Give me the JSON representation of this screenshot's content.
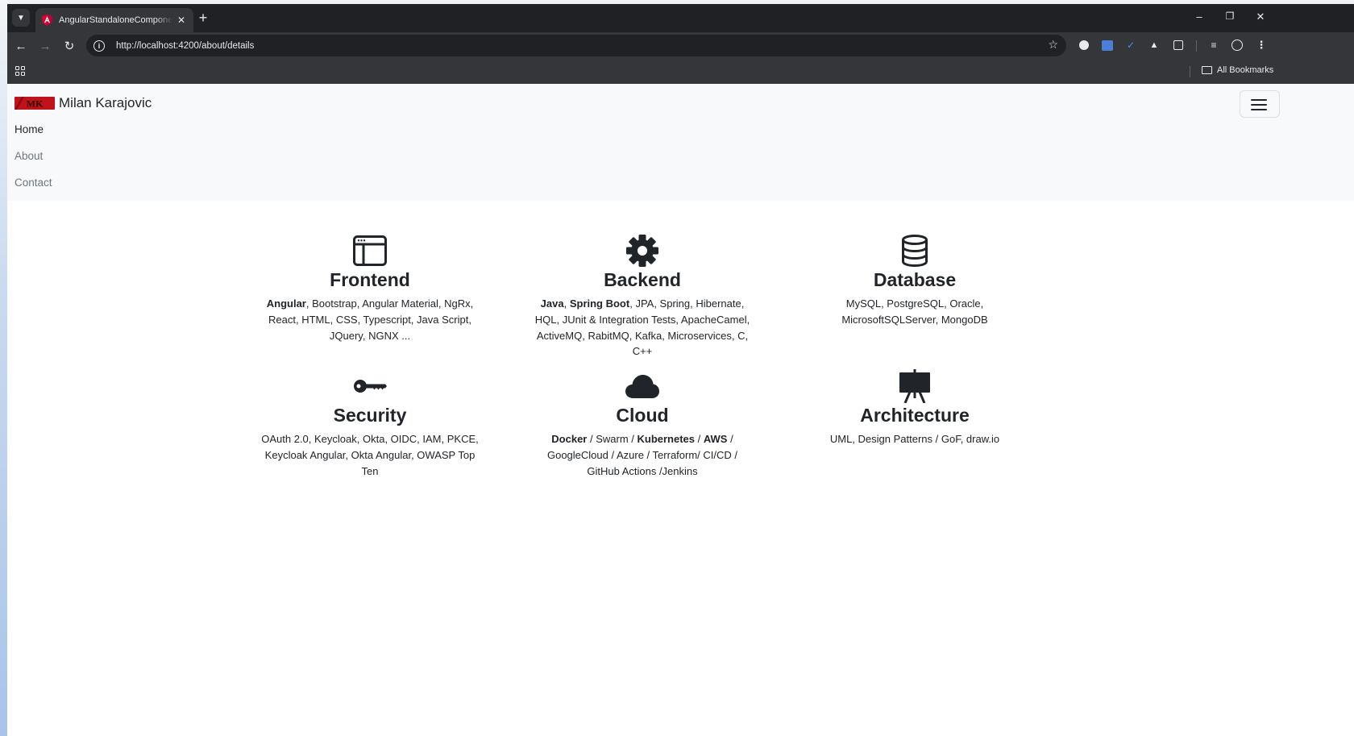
{
  "browser": {
    "tab_title": "AngularStandaloneComponents",
    "tab_close": "✕",
    "new_tab": "+",
    "url": "http://localhost:4200/about/details",
    "bookmarks_label": "All Bookmarks",
    "window_controls": {
      "minimize": "–",
      "restore": "❐",
      "close": "✕"
    }
  },
  "navbar": {
    "brand_name": "Milan Karajovic",
    "brand_logo_text": "MK",
    "links": [
      {
        "label": "Home",
        "active": true
      },
      {
        "label": "About",
        "active": false
      },
      {
        "label": "Contact",
        "active": false
      }
    ]
  },
  "skills": [
    {
      "icon": "window-icon",
      "title": "Frontend",
      "parts": [
        {
          "t": "Angular",
          "b": true
        },
        {
          "t": ", Bootstrap, Angular Material, NgRx, React, HTML, CSS, Typescript, Java Script, JQuery, NGNX ...",
          "b": false
        }
      ]
    },
    {
      "icon": "gear-icon",
      "title": "Backend",
      "parts": [
        {
          "t": "Java",
          "b": true
        },
        {
          "t": ", ",
          "b": false
        },
        {
          "t": "Spring Boot",
          "b": true
        },
        {
          "t": ", JPA, Spring, Hibernate, HQL, JUnit & Integration Tests, ApacheCamel, ActiveMQ, RabitMQ, Kafka, Microservices, C, C++",
          "b": false
        }
      ]
    },
    {
      "icon": "database-icon",
      "title": "Database",
      "parts": [
        {
          "t": "MySQL, PostgreSQL, Oracle, MicrosoftSQLServer, MongoDB",
          "b": false
        }
      ]
    },
    {
      "icon": "key-icon",
      "title": "Security",
      "parts": [
        {
          "t": "OAuth 2.0, Keycloak, Okta, OIDC, IAM, PKCE, Keycloak Angular, Okta Angular, OWASP Top Ten",
          "b": false
        }
      ]
    },
    {
      "icon": "cloud-icon",
      "title": "Cloud",
      "parts": [
        {
          "t": "Docker",
          "b": true
        },
        {
          "t": " / Swarm / ",
          "b": false
        },
        {
          "t": "Kubernetes",
          "b": true
        },
        {
          "t": " / ",
          "b": false
        },
        {
          "t": "AWS",
          "b": true
        },
        {
          "t": " / GoogleCloud / Azure / Terraform/ CI/CD / GitHub Actions /Jenkins",
          "b": false
        }
      ]
    },
    {
      "icon": "easel-icon",
      "title": "Architecture",
      "parts": [
        {
          "t": "UML, Design Patterns / GoF, draw.io",
          "b": false
        }
      ]
    }
  ]
}
